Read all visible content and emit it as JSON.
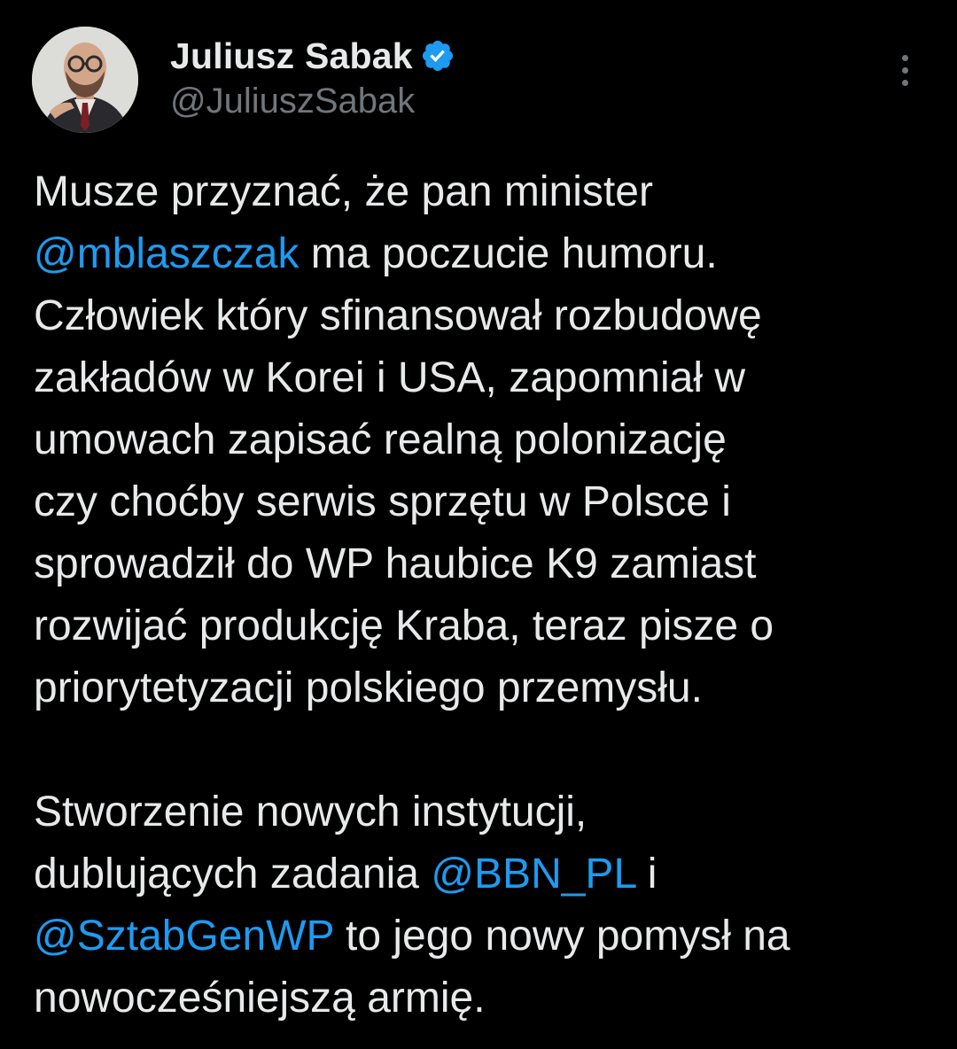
{
  "author": {
    "display_name": "Juliusz Sabak",
    "handle": "@JuliuszSabak",
    "verified_icon": "verified-badge-icon",
    "avatar": "profile-photo"
  },
  "colors": {
    "background": "#000000",
    "text": "#e7e9ea",
    "secondary": "#71767b",
    "accent": "#1d9bf0"
  },
  "more_icon": "more-vertical-icon",
  "paragraph1": {
    "l1": "Musze przyznać, że pan minister",
    "l2_mention": "@mblaszczak",
    "l2_rest": " ma poczucie humoru.",
    "l3": "Człowiek który sfinansował rozbudowę",
    "l4": "zakładów w Korei i USA, zapomniał w",
    "l5": "umowach zapisać realną polonizację",
    "l6": "czy choćby serwis sprzętu w Polsce i",
    "l7": "sprowadził do WP haubice K9 zamiast",
    "l8": "rozwijać produkcję Kraba, teraz pisze o",
    "l9": "priorytetyzacji polskiego przemysłu."
  },
  "paragraph2": {
    "l1": "Stworzenie nowych instytucji,",
    "l2_text": "dublujących zadania ",
    "l2_mention": "@BBN_PL",
    "l2_rest": " i",
    "l3_mention": "@SztabGenWP",
    "l3_rest": " to jego nowy pomysł na",
    "l4": "nowocześniejszą armię."
  }
}
